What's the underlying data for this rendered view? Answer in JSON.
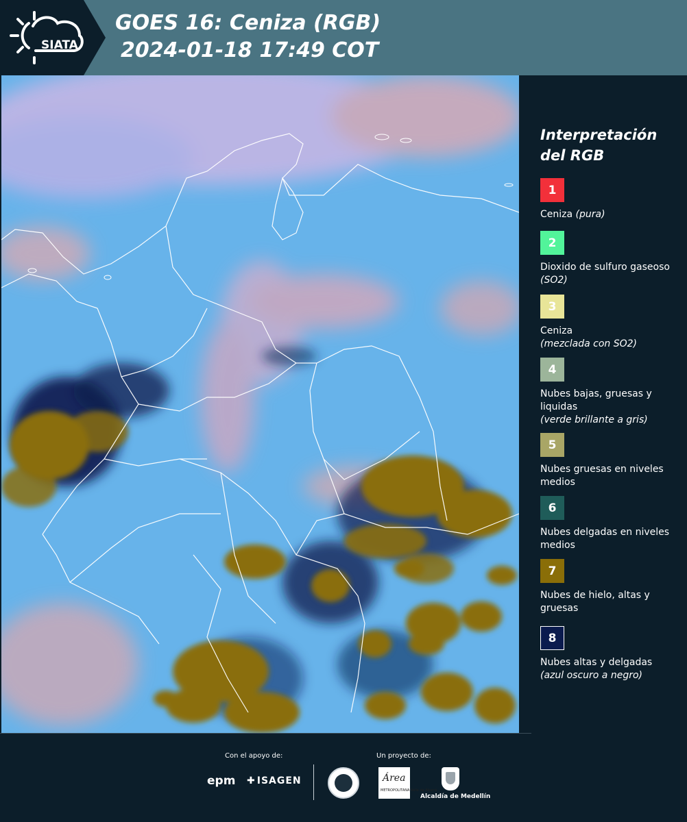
{
  "header": {
    "brand": "SIATA",
    "title": "GOES 16: Ceniza (RGB)",
    "datetime": "2024-01-18 17:49 COT"
  },
  "legend": {
    "title": "Interpretación del RGB",
    "items": [
      {
        "number": "1",
        "label": "Ceniza",
        "note": "(pura)",
        "color": "#f2303a"
      },
      {
        "number": "2",
        "label": "Dioxido de sulfuro gaseoso",
        "note": "(SO2)",
        "color": "#52f49a"
      },
      {
        "number": "3",
        "label": "Ceniza",
        "note": "(mezclada con SO2)",
        "color": "#e8e598"
      },
      {
        "number": "4",
        "label": "Nubes bajas, gruesas y liquidas",
        "note": "(verde brillante a gris)",
        "color": "#9cb59a"
      },
      {
        "number": "5",
        "label": "Nubes gruesas en niveles medios",
        "note": "",
        "color": "#a9a666"
      },
      {
        "number": "6",
        "label": "Nubes delgadas en niveles medios",
        "note": "",
        "color": "#1f5c59"
      },
      {
        "number": "7",
        "label": "Nubes de hielo, altas y gruesas",
        "note": "",
        "color": "#8a6e08"
      },
      {
        "number": "8",
        "label": "Nubes altas y delgadas",
        "note": "(azul oscuro a negro)",
        "color": "#0b1b4e"
      }
    ]
  },
  "footer": {
    "support_label": "Con el apoyo de:",
    "project_label": "Un proyecto de:",
    "sponsor_1": "epm",
    "sponsor_2": "ISAGEN",
    "partner_area": "Área",
    "partner_area_sub": "METROPOLITANA Valle de Aburrá",
    "partner_medellin": "Alcaldía de Medellín"
  },
  "colors": {
    "background": "#0c1e2a",
    "header_band": "#4a7482",
    "map_sky": "#67b3ea",
    "cloud_ice": "#8a6e08",
    "cloud_pink": "#d9a9b8"
  }
}
